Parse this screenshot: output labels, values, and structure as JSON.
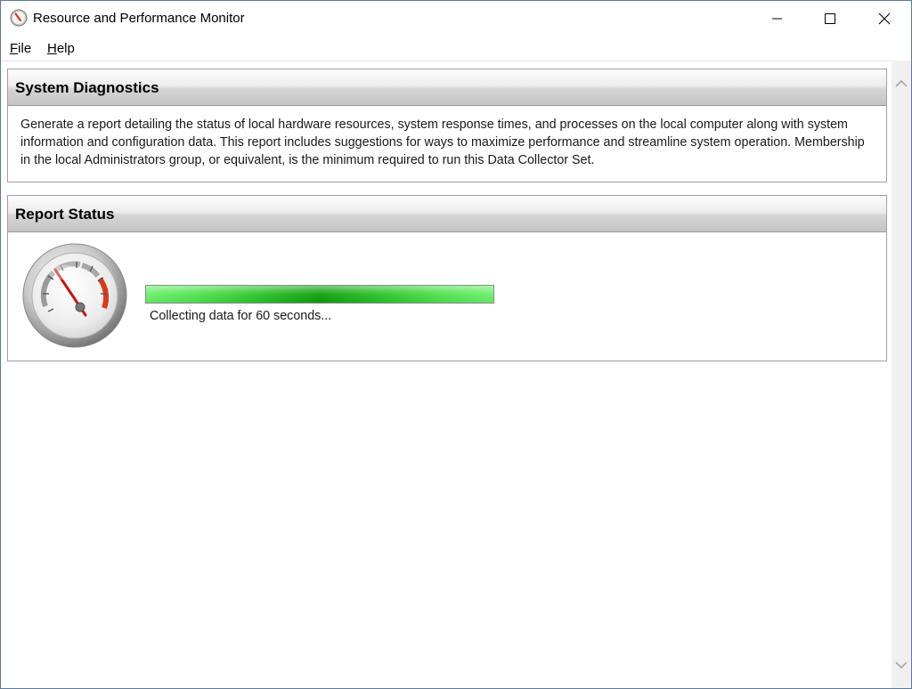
{
  "window": {
    "title": "Resource and Performance Monitor",
    "icon": "performance-gauge-icon"
  },
  "title_controls": {
    "minimize_icon": "minimize-icon",
    "maximize_icon": "maximize-icon",
    "close_icon": "close-icon"
  },
  "menu": {
    "items": [
      {
        "accel": "F",
        "rest": "ile"
      },
      {
        "accel": "H",
        "rest": "elp"
      }
    ]
  },
  "diagnostics": {
    "header": "System Diagnostics",
    "description": "Generate a report detailing the status of local hardware resources, system response times, and processes on the local computer along with system information and configuration data. This report includes suggestions for ways to maximize performance and streamline system operation. Membership in the local Administrators group, or equivalent, is the minimum required to run this Data Collector Set."
  },
  "report_status": {
    "header": "Report Status",
    "gauge_icon": "speedometer-gauge-icon",
    "progress_fraction": 1.0,
    "status_text": "Collecting data for 60 seconds..."
  },
  "scrollbar": {
    "up_icon": "scroll-up-arrow-icon",
    "down_icon": "scroll-down-arrow-icon"
  },
  "colors": {
    "progress_green": "#2fc82f",
    "gauge_red": "#d93a1a"
  }
}
